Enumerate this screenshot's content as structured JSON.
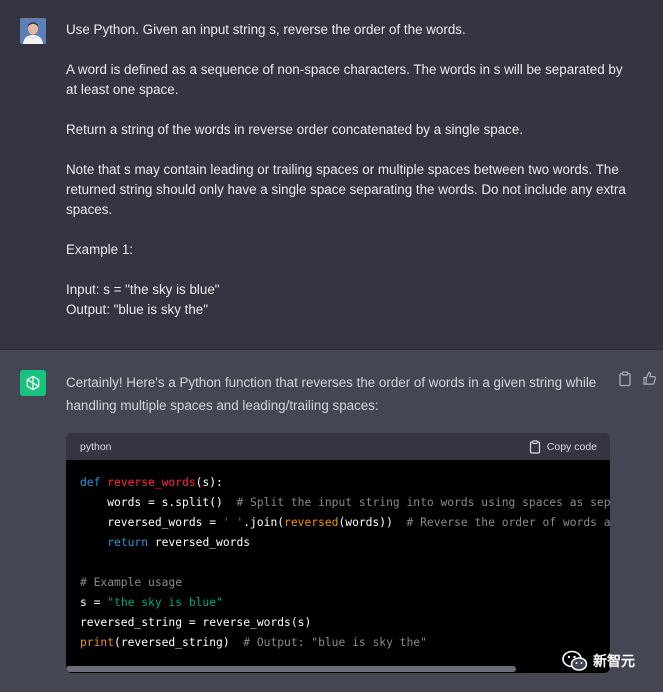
{
  "user_message": {
    "paragraphs": [
      "Use Python. Given an input string s, reverse the order of the words.",
      "A word is defined as a sequence of non-space characters. The words in s will be separated by at least one space.",
      "Return a string of the words in reverse order concatenated by a single space.",
      "Note that s may contain leading or trailing spaces or multiple spaces between two words. The returned string should only have a single space separating the words. Do not include any extra spaces.",
      "Example 1:",
      "Input: s = \"the sky is blue\"\nOutput: \"blue is sky the\""
    ]
  },
  "assistant_message": {
    "intro": "Certainly! Here's a Python function that reverses the order of words in a given string while handling multiple spaces and leading/trailing spaces:",
    "code_block": {
      "language": "python",
      "copy_label": "Copy code"
    }
  },
  "watermark": {
    "text": "新智元"
  },
  "colors": {
    "user_bg": "#343541",
    "assistant_bg": "#444654",
    "bot_avatar": "#19c37d",
    "code_bg": "#000000",
    "keyword": "#2e95d3",
    "function": "#f22c3d",
    "string": "#00a67d",
    "comment": "#8a8a8a"
  },
  "icons": {
    "copy_message": "clipboard-icon",
    "thumbs_up": "thumbs-up-icon",
    "copy_code": "clipboard-icon",
    "bot_avatar": "openai-logo-icon",
    "watermark": "wechat-icon"
  }
}
